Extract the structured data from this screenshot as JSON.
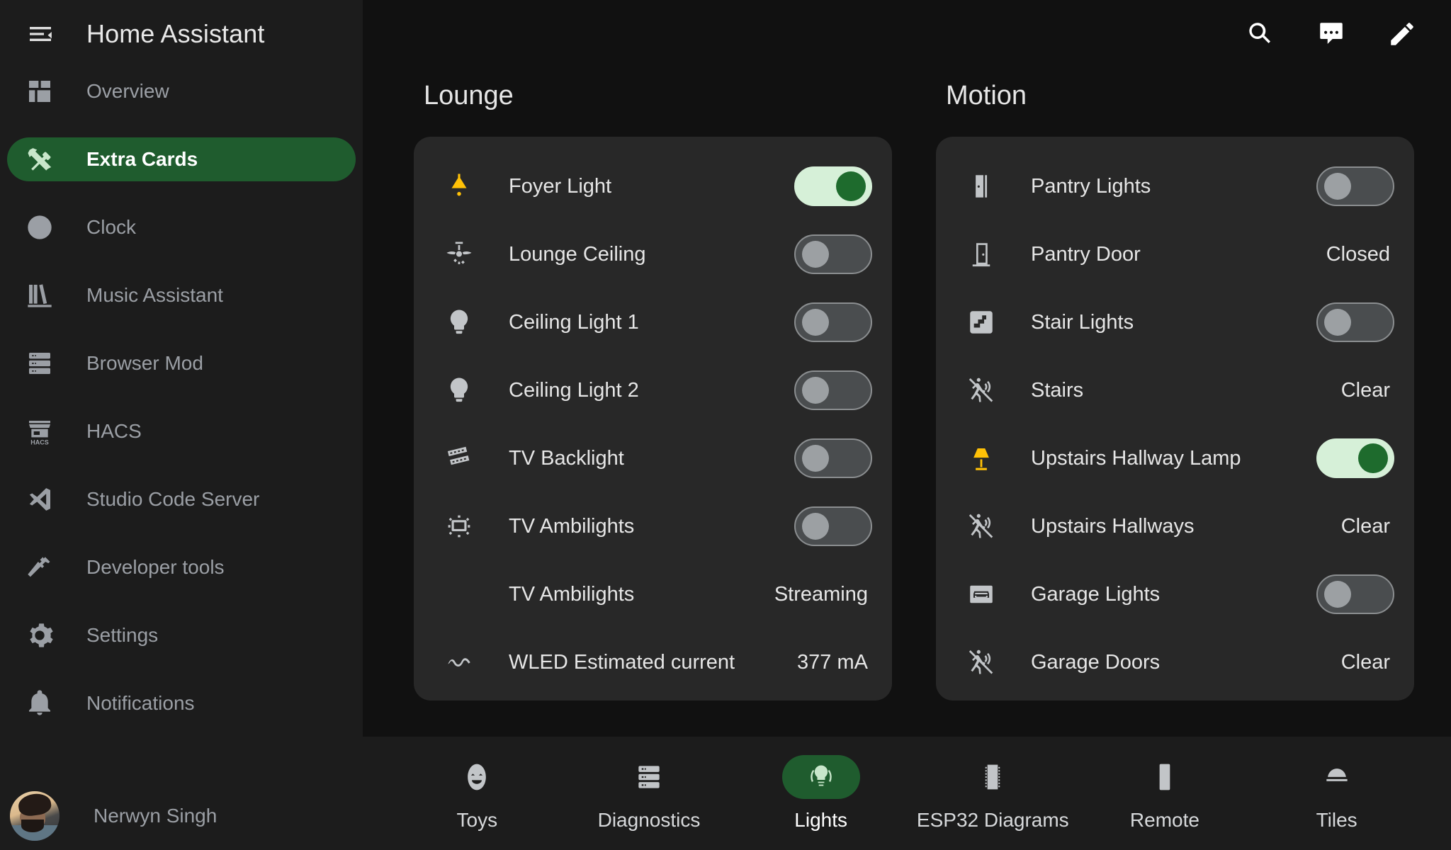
{
  "app": {
    "title": "Home Assistant",
    "menu_icon": "hamburger-collapse-icon"
  },
  "topbar": {
    "search_icon": "search-icon",
    "assist_icon": "conversation-icon",
    "edit_icon": "pencil-icon"
  },
  "sidebar": {
    "items": [
      {
        "label": "Overview",
        "icon": "view-dashboard-icon",
        "active": false
      },
      {
        "label": "Extra Cards",
        "icon": "tools-icon",
        "active": true
      },
      {
        "label": "Clock",
        "icon": "clock-icon",
        "active": false
      },
      {
        "label": "Music Assistant",
        "icon": "bookshelf-icon",
        "active": false
      },
      {
        "label": "Browser Mod",
        "icon": "server-icon",
        "active": false
      },
      {
        "label": "HACS",
        "icon": "hacs-store-icon",
        "active": false
      },
      {
        "label": "Studio Code Server",
        "icon": "vscode-icon",
        "active": false
      },
      {
        "label": "Developer tools",
        "icon": "hammer-icon",
        "active": false
      },
      {
        "label": "Settings",
        "icon": "cog-icon",
        "active": false
      },
      {
        "label": "Notifications",
        "icon": "bell-icon",
        "active": false
      }
    ],
    "user": {
      "name": "Nerwyn Singh",
      "avatar": "user-avatar"
    }
  },
  "columns": [
    {
      "title": "Lounge",
      "rows": [
        {
          "name": "Foyer Light",
          "icon": "ceiling-light-icon",
          "icon_color": "amber",
          "control": "toggle",
          "on": true
        },
        {
          "name": "Lounge Ceiling",
          "icon": "ceiling-fan-light-icon",
          "icon_color": "grey",
          "control": "toggle",
          "on": false
        },
        {
          "name": "Ceiling Light 1",
          "icon": "lightbulb-icon",
          "icon_color": "grey",
          "control": "toggle",
          "on": false
        },
        {
          "name": "Ceiling Light 2",
          "icon": "lightbulb-icon",
          "icon_color": "grey",
          "control": "toggle",
          "on": false
        },
        {
          "name": "TV Backlight",
          "icon": "led-strip-icon",
          "icon_color": "grey",
          "control": "toggle",
          "on": false
        },
        {
          "name": "TV Ambilights",
          "icon": "television-ambient-icon",
          "icon_color": "grey",
          "control": "toggle",
          "on": false
        },
        {
          "name": "TV Ambilights",
          "icon": "none",
          "icon_color": "grey",
          "control": "state",
          "state": "Streaming"
        },
        {
          "name": "WLED Estimated current",
          "icon": "current-ac-icon",
          "icon_color": "grey",
          "control": "state",
          "state": "377 mA"
        }
      ]
    },
    {
      "title": "Motion",
      "rows": [
        {
          "name": "Pantry Lights",
          "icon": "door-open-icon",
          "icon_color": "grey",
          "control": "toggle",
          "on": false
        },
        {
          "name": "Pantry Door",
          "icon": "door-closed-icon",
          "icon_color": "grey",
          "control": "state",
          "state": "Closed"
        },
        {
          "name": "Stair Lights",
          "icon": "stairs-icon",
          "icon_color": "grey",
          "control": "toggle",
          "on": false
        },
        {
          "name": "Stairs",
          "icon": "motion-sensor-off-icon",
          "icon_color": "grey",
          "control": "state",
          "state": "Clear"
        },
        {
          "name": "Upstairs Hallway Lamp",
          "icon": "lamp-icon",
          "icon_color": "amber",
          "control": "toggle",
          "on": true
        },
        {
          "name": "Upstairs Hallways",
          "icon": "motion-sensor-off-icon",
          "icon_color": "grey",
          "control": "state",
          "state": "Clear"
        },
        {
          "name": "Garage Lights",
          "icon": "garage-icon",
          "icon_color": "grey",
          "control": "toggle",
          "on": false
        },
        {
          "name": "Garage Doors",
          "icon": "motion-sensor-off-icon",
          "icon_color": "grey",
          "control": "state",
          "state": "Clear"
        }
      ]
    }
  ],
  "bottom_nav": {
    "items": [
      {
        "label": "Toys",
        "icon": "emoticon-icon",
        "active": false
      },
      {
        "label": "Diagnostics",
        "icon": "server-icon",
        "active": false
      },
      {
        "label": "Lights",
        "icon": "lightbulb-group-icon",
        "active": true
      },
      {
        "label": "ESP32 Diagrams",
        "icon": "chip-icon",
        "active": false
      },
      {
        "label": "Remote",
        "icon": "remote-icon",
        "active": false
      },
      {
        "label": "Tiles",
        "icon": "dome-light-icon",
        "active": false
      }
    ]
  },
  "colors": {
    "accent_green": "#1f5c2e",
    "toggle_on_track": "#d6f0d8",
    "toggle_on_knob": "#1e6b2d",
    "card_bg": "#282828",
    "page_bg": "#111111",
    "sidebar_bg": "#1c1c1c",
    "amber": "#ffc107",
    "muted_text": "#9b9fa5"
  }
}
